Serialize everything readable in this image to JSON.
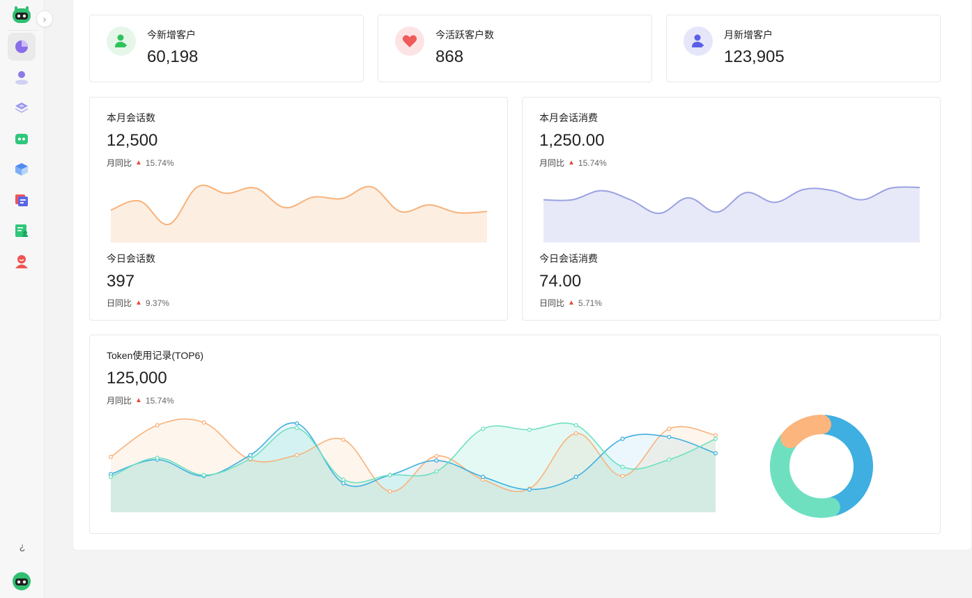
{
  "sidebar": {
    "items": [
      {
        "name": "dashboard",
        "icon": "pie-chart-icon",
        "active": true
      },
      {
        "name": "customers",
        "icon": "user-icon"
      },
      {
        "name": "knowledge",
        "icon": "layers-icon"
      },
      {
        "name": "robots",
        "icon": "robot-icon"
      },
      {
        "name": "models",
        "icon": "cube-icon"
      },
      {
        "name": "conversations",
        "icon": "chat-cards-icon"
      },
      {
        "name": "records",
        "icon": "document-user-icon"
      },
      {
        "name": "accounts",
        "icon": "person-icon"
      }
    ],
    "toggle_icon": "›",
    "bottom_link_icon": "¿"
  },
  "stats": [
    {
      "label": "今新增客户",
      "value": "60,198",
      "color": "#2fc35c",
      "bg": "#e6f7ea"
    },
    {
      "label": "今活跃客户数",
      "value": "868",
      "color": "#ef5a5a",
      "bg": "#fde4e4"
    },
    {
      "label": "月新增客户",
      "value": "123,905",
      "color": "#5a5ee8",
      "bg": "#e6e6fa"
    }
  ],
  "session_card": {
    "month_title": "本月会话数",
    "month_value": "12,500",
    "month_cmp_label": "月同比",
    "month_cmp_pct": "15.74%",
    "day_title": "今日会话数",
    "day_value": "397",
    "day_cmp_label": "日同比",
    "day_cmp_pct": "9.37%"
  },
  "cost_card": {
    "month_title": "本月会话消费",
    "month_value": "1,250.00",
    "month_cmp_label": "月同比",
    "month_cmp_pct": "15.74%",
    "day_title": "今日会话消费",
    "day_value": "74.00",
    "day_cmp_label": "日同比",
    "day_cmp_pct": "5.71%"
  },
  "token_card": {
    "title": "Token使用记录(TOP6)",
    "value": "125,000",
    "cmp_label": "月同比",
    "cmp_pct": "15.74%"
  },
  "chart_data": [
    {
      "type": "area",
      "values": [
        50,
        64,
        28,
        86,
        76,
        84,
        54,
        70,
        68,
        86,
        48,
        58,
        46,
        48
      ],
      "ylim": [
        0,
        100
      ],
      "color": "#f7b27a",
      "fill": "#fdeee2"
    },
    {
      "type": "area",
      "values": [
        66,
        66,
        80,
        66,
        45,
        69,
        47,
        77,
        62,
        82,
        80,
        66,
        84,
        85
      ],
      "ylim": [
        0,
        100
      ],
      "color": "#9aa1e2",
      "fill": "#e8e9f8"
    },
    {
      "type": "line",
      "x": [
        1,
        2,
        3,
        4,
        5,
        6,
        7,
        8,
        9,
        10,
        11,
        12,
        13,
        14
      ],
      "ylim": [
        0,
        100
      ],
      "series": [
        {
          "values": [
            58,
            93,
            96,
            55,
            60,
            77,
            20,
            59,
            33,
            23,
            84,
            37,
            89,
            82
          ],
          "color": "#f7b27a"
        },
        {
          "values": [
            39,
            55,
            37,
            60,
            95,
            29,
            38,
            54,
            36,
            22,
            36,
            78,
            80,
            62
          ],
          "color": "#3eafe0"
        },
        {
          "values": [
            36,
            57,
            38,
            56,
            90,
            33,
            38,
            42,
            89,
            88,
            93,
            47,
            55,
            78
          ],
          "color": "#6ee0c0"
        }
      ]
    },
    {
      "type": "pie",
      "values": [
        45,
        40,
        15
      ],
      "colors": [
        "#3eafe0",
        "#6ee0c0",
        "#fbb57d"
      ]
    }
  ]
}
